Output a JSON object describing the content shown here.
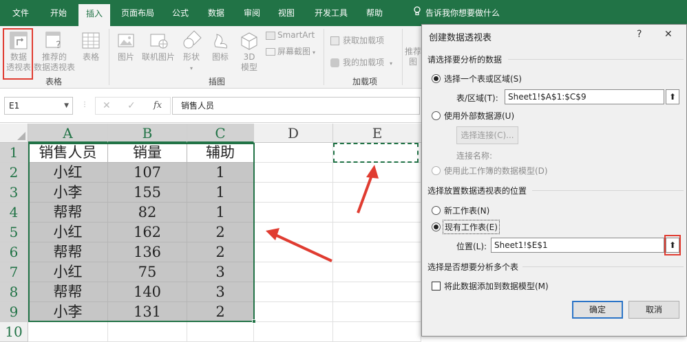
{
  "ribbon_tabs": [
    "文件",
    "开始",
    "插入",
    "页面布局",
    "公式",
    "数据",
    "审阅",
    "视图",
    "开发工具",
    "帮助"
  ],
  "tell_me": "告诉我你想要做什么",
  "ribbon": {
    "pivot_line1": "数据",
    "pivot_line2": "透视表",
    "recommended_line1": "推荐的",
    "recommended_line2": "数据透视表",
    "table": "表格",
    "group_tables": "表格",
    "picture": "图片",
    "online_picture": "联机图片",
    "shapes": "形状",
    "icons": "图标",
    "model3d_line1": "3D",
    "model3d_line2": "模型",
    "smartart": "SmartArt",
    "screenshot": "屏幕截图",
    "group_illustrations": "插图",
    "get_addins": "获取加载项",
    "my_addins": "我的加载项",
    "group_addins": "加载项",
    "recommended_charts_partial_1": "推荐",
    "recommended_charts_partial_2": "图"
  },
  "formula_bar": {
    "name_box": "E1",
    "fx": "fx",
    "formula": "销售人员"
  },
  "sheet": {
    "columns": [
      "A",
      "B",
      "C",
      "D",
      "E"
    ],
    "rows": [
      "1",
      "2",
      "3",
      "4",
      "5",
      "6",
      "7",
      "8",
      "9",
      "10"
    ],
    "headers": [
      "销售人员",
      "销量",
      "辅助"
    ],
    "data": [
      [
        "小红",
        "107",
        "1"
      ],
      [
        "小李",
        "155",
        "1"
      ],
      [
        "帮帮",
        "82",
        "1"
      ],
      [
        "小红",
        "162",
        "2"
      ],
      [
        "帮帮",
        "136",
        "2"
      ],
      [
        "小红",
        "75",
        "3"
      ],
      [
        "帮帮",
        "140",
        "3"
      ],
      [
        "小李",
        "131",
        "2"
      ]
    ]
  },
  "dialog": {
    "title": "创建数据透视表",
    "help": "?",
    "close": "✕",
    "section_analyze": "请选择要分析的数据",
    "opt_select_table": "选择一个表或区域(S)",
    "table_range_label": "表/区域(T):",
    "table_range_value": "Sheet1!$A$1:$C$9",
    "opt_external": "使用外部数据源(U)",
    "choose_connection": "选择连接(C)...",
    "connection_name": "连接名称:",
    "opt_data_model": "使用此工作簿的数据模型(D)",
    "section_location": "选择放置数据透视表的位置",
    "opt_new_sheet": "新工作表(N)",
    "opt_existing_sheet": "现有工作表(E)",
    "location_label": "位置(L):",
    "location_value": "Sheet1!$E$1",
    "section_multi": "选择是否想要分析多个表",
    "add_to_model": "将此数据添加到数据模型(M)",
    "ok": "确定",
    "cancel": "取消"
  },
  "colors": {
    "excel_green": "#217346",
    "highlight_red": "#e03c31",
    "primary_button_border": "#2b74c7"
  }
}
